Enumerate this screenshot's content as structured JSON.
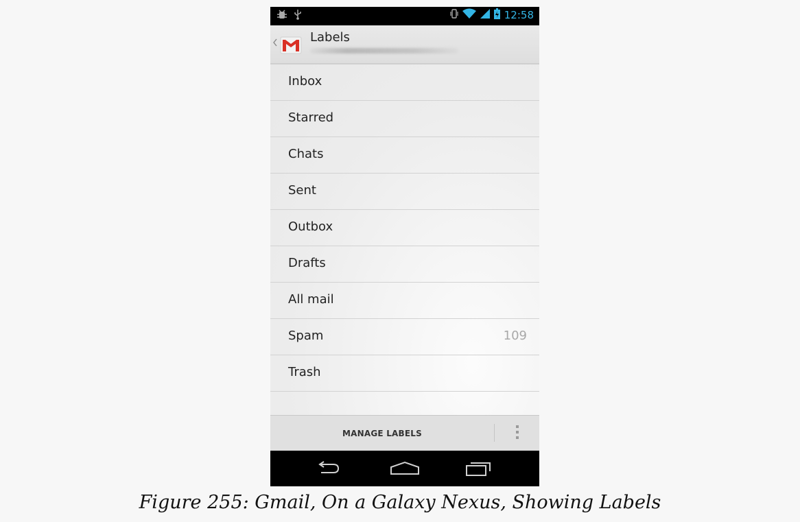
{
  "status_bar": {
    "time": "12:58"
  },
  "action_bar": {
    "title": "Labels"
  },
  "labels": [
    {
      "name": "Inbox",
      "count": ""
    },
    {
      "name": "Starred",
      "count": ""
    },
    {
      "name": "Chats",
      "count": ""
    },
    {
      "name": "Sent",
      "count": ""
    },
    {
      "name": "Outbox",
      "count": ""
    },
    {
      "name": "Drafts",
      "count": ""
    },
    {
      "name": "All mail",
      "count": ""
    },
    {
      "name": "Spam",
      "count": "109"
    },
    {
      "name": "Trash",
      "count": ""
    }
  ],
  "bottom_bar": {
    "manage_label": "MANAGE LABELS"
  },
  "caption": "Figure 255: Gmail, On a Galaxy Nexus, Showing Labels",
  "colors": {
    "accent": "#33b5e5",
    "gmail_red": "#d93025"
  },
  "icons": [
    "debug-icon",
    "usb-icon",
    "vibrate-icon",
    "wifi-icon",
    "signal-icon",
    "battery-icon",
    "gmail-icon",
    "up-caret-icon",
    "overflow-menu-icon",
    "back-icon",
    "home-icon",
    "recent-apps-icon"
  ]
}
